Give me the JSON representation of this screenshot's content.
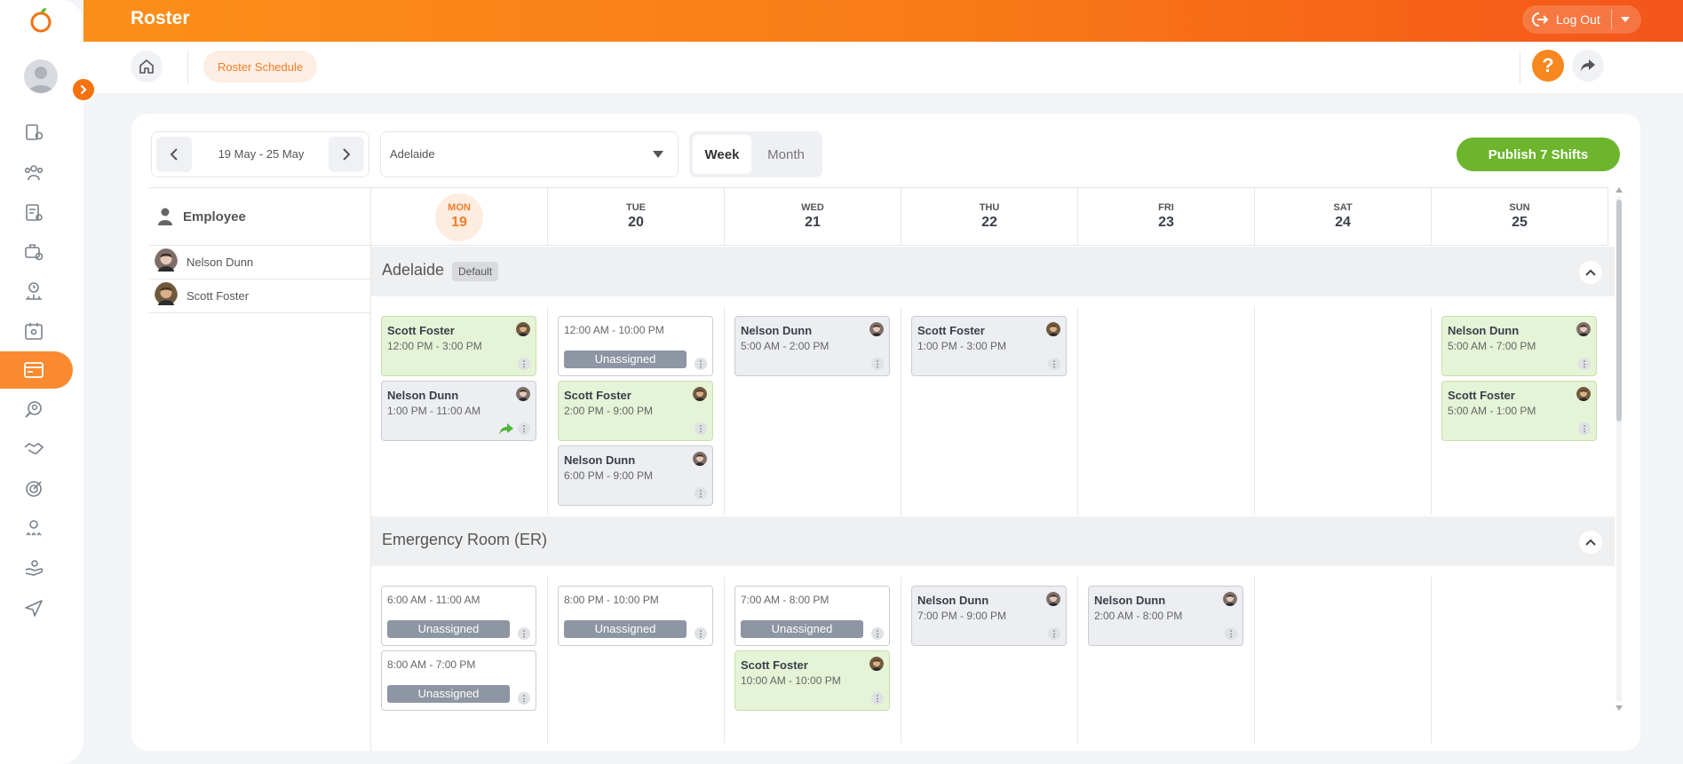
{
  "app": {
    "title": "Roster",
    "logout_label": "Log Out"
  },
  "breadcrumb": {
    "current": "Roster Schedule"
  },
  "help": {
    "label": "?"
  },
  "nav": {
    "items": [
      "building-people-icon",
      "team-icon",
      "document-user-icon",
      "briefcase-gear-icon",
      "clock-people-icon",
      "calendar-user-icon",
      "roster-card-icon",
      "search-person-icon",
      "handshake-icon",
      "target-icon",
      "award-people-icon",
      "hand-care-icon",
      "plane-icon"
    ],
    "active_index": 6
  },
  "toolbar": {
    "date_range": "19 May - 25 May",
    "location": "Adelaide",
    "view_week": "Week",
    "view_month": "Month",
    "publish_label": "Publish 7 Shifts"
  },
  "employees": {
    "header": "Employee",
    "list": [
      {
        "name": "Nelson Dunn"
      },
      {
        "name": "Scott Foster"
      }
    ]
  },
  "days": [
    {
      "name": "MON",
      "num": "19",
      "today": true
    },
    {
      "name": "TUE",
      "num": "20"
    },
    {
      "name": "WED",
      "num": "21"
    },
    {
      "name": "THU",
      "num": "22"
    },
    {
      "name": "FRI",
      "num": "23"
    },
    {
      "name": "SAT",
      "num": "24"
    },
    {
      "name": "SUN",
      "num": "25"
    }
  ],
  "sections": [
    {
      "title": "Adelaide",
      "badge": "Default",
      "shifts": [
        {
          "day": 0,
          "slot": 0,
          "employee": "Scott Foster",
          "time": "12:00 PM - 3:00 PM",
          "status": "green"
        },
        {
          "day": 0,
          "slot": 1,
          "employee": "Nelson Dunn",
          "time": "1:00 PM - 11:00 AM",
          "status": "grey",
          "swap": true
        },
        {
          "day": 1,
          "slot": 0,
          "employee": "",
          "time": "12:00 AM - 10:00 PM",
          "status": "unassigned",
          "unassigned_label": "Unassigned"
        },
        {
          "day": 1,
          "slot": 1,
          "employee": "Scott Foster",
          "time": "2:00 PM - 9:00 PM",
          "status": "green"
        },
        {
          "day": 1,
          "slot": 2,
          "employee": "Nelson Dunn",
          "time": "6:00 PM - 9:00 PM",
          "status": "grey"
        },
        {
          "day": 2,
          "slot": 0,
          "employee": "Nelson Dunn",
          "time": "5:00 AM - 2:00 PM",
          "status": "grey"
        },
        {
          "day": 3,
          "slot": 0,
          "employee": "Scott Foster",
          "time": "1:00 PM - 3:00 PM",
          "status": "grey"
        },
        {
          "day": 6,
          "slot": 0,
          "employee": "Nelson Dunn",
          "time": "5:00 AM - 7:00 PM",
          "status": "green"
        },
        {
          "day": 6,
          "slot": 1,
          "employee": "Scott Foster",
          "time": "5:00 AM - 1:00 PM",
          "status": "green"
        }
      ]
    },
    {
      "title": "Emergency Room (ER)",
      "badge": "",
      "shifts": [
        {
          "day": 0,
          "slot": 0,
          "employee": "",
          "time": "6:00 AM - 11:00 AM",
          "status": "unassigned",
          "unassigned_label": "Unassigned"
        },
        {
          "day": 0,
          "slot": 1,
          "employee": "",
          "time": "8:00 AM - 7:00 PM",
          "status": "unassigned",
          "unassigned_label": "Unassigned"
        },
        {
          "day": 1,
          "slot": 0,
          "employee": "",
          "time": "8:00 PM - 10:00 PM",
          "status": "unassigned",
          "unassigned_label": "Unassigned"
        },
        {
          "day": 2,
          "slot": 0,
          "employee": "",
          "time": "7:00 AM - 8:00 PM",
          "status": "unassigned",
          "unassigned_label": "Unassigned"
        },
        {
          "day": 2,
          "slot": 1,
          "employee": "Scott Foster",
          "time": "10:00 AM - 10:00 PM",
          "status": "green"
        },
        {
          "day": 3,
          "slot": 0,
          "employee": "Nelson Dunn",
          "time": "7:00 PM - 9:00 PM",
          "status": "grey"
        },
        {
          "day": 4,
          "slot": 0,
          "employee": "Nelson Dunn",
          "time": "2:00 AM - 8:00 PM",
          "status": "grey"
        }
      ]
    }
  ],
  "colors": {
    "accent": "#f5720f",
    "publish": "#6cb52c",
    "shift_green": "#e5f3d6",
    "shift_grey": "#eceef1",
    "unassigned": "#8e95a3"
  }
}
